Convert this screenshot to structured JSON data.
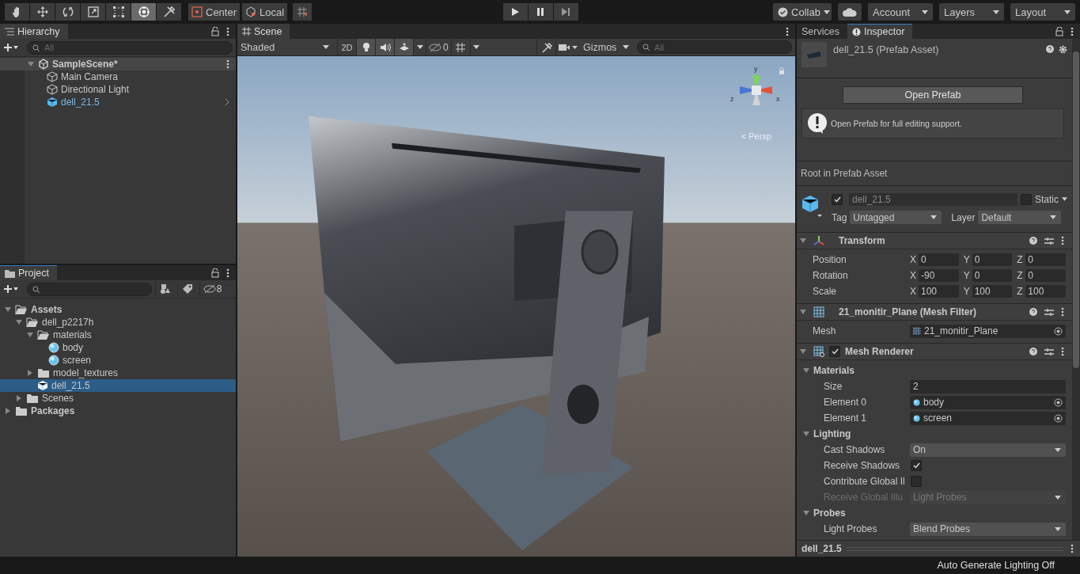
{
  "toolbar": {
    "tools": [
      {
        "kind": "hand",
        "selected": false
      },
      {
        "kind": "move",
        "selected": false
      },
      {
        "kind": "rotate",
        "selected": false
      },
      {
        "kind": "scale",
        "selected": false
      },
      {
        "kind": "rect",
        "selected": false
      },
      {
        "kind": "transform",
        "selected": true
      },
      {
        "kind": "custom",
        "selected": false
      }
    ],
    "pivot": "Center",
    "space": "Local",
    "play_controls": [
      {
        "kind": "play"
      },
      {
        "kind": "pause"
      },
      {
        "kind": "step"
      }
    ],
    "collab": "Collab",
    "account": "Account",
    "layers": "Layers",
    "layout": "Layout"
  },
  "hierarchy": {
    "title": "Hierarchy",
    "search_placeholder": "All",
    "scene": "SampleScene*",
    "expanded": true,
    "items": [
      {
        "name": "Main Camera",
        "kind": "object",
        "selected": false
      },
      {
        "name": "Directional Light",
        "kind": "object",
        "selected": false
      },
      {
        "name": "dell_21.5",
        "kind": "prefab",
        "selected": false
      }
    ]
  },
  "project": {
    "title": "Project",
    "hidden_count": "8",
    "tree": [
      {
        "name": "Assets",
        "kind": "folder",
        "expanded": true,
        "selected": false,
        "children": [
          {
            "name": "dell_p2217h",
            "kind": "folder",
            "expanded": true,
            "selected": false,
            "children": [
              {
                "name": "materials",
                "kind": "folder",
                "expanded": true,
                "selected": false,
                "children": [
                  {
                    "name": "body",
                    "kind": "material",
                    "selected": false
                  },
                  {
                    "name": "screen",
                    "kind": "material",
                    "selected": false
                  }
                ]
              },
              {
                "name": "model_textures",
                "kind": "folder",
                "expanded": false,
                "selected": false
              },
              {
                "name": "dell_21.5",
                "kind": "prefab",
                "selected": true
              }
            ]
          },
          {
            "name": "Scenes",
            "kind": "folder",
            "expanded": false,
            "selected": false
          }
        ]
      },
      {
        "name": "Packages",
        "kind": "folder",
        "expanded": false,
        "selected": false
      }
    ]
  },
  "scene": {
    "tab": "Scene",
    "shading": "Shaded",
    "mode_2d": "2D",
    "hidden_count": "0",
    "gizmos": "Gizmos",
    "search_placeholder": "All",
    "axes": [
      "y",
      "x",
      "z"
    ],
    "projection": "< Persp"
  },
  "inspector": {
    "tabs": [
      {
        "label": "Services",
        "selected": false
      },
      {
        "label": "Inspector",
        "selected": true
      }
    ],
    "asset_title": "dell_21.5 (Prefab Asset)",
    "open_button": "Open Prefab",
    "help_message": "Open Prefab for full editing support.",
    "root_label": "Root in Prefab Asset",
    "object": {
      "active": true,
      "name": "dell_21.5",
      "static": false,
      "static_label": "Static",
      "tag_label": "Tag",
      "tag": "Untagged",
      "layer_label": "Layer",
      "layer": "Default"
    },
    "components": [
      {
        "kind": "transform",
        "title": "Transform",
        "expanded": true,
        "rows": [
          {
            "kind": "vector",
            "label": "Position",
            "axes": [
              {
                "axis": "X",
                "value": "0"
              },
              {
                "axis": "Y",
                "value": "0"
              },
              {
                "axis": "Z",
                "value": "0"
              }
            ]
          },
          {
            "kind": "vector",
            "label": "Rotation",
            "axes": [
              {
                "axis": "X",
                "value": "-90"
              },
              {
                "axis": "Y",
                "value": "0"
              },
              {
                "axis": "Z",
                "value": "0"
              }
            ]
          },
          {
            "kind": "vector",
            "label": "Scale",
            "axes": [
              {
                "axis": "X",
                "value": "100"
              },
              {
                "axis": "Y",
                "value": "100"
              },
              {
                "axis": "Z",
                "value": "100"
              }
            ]
          }
        ]
      },
      {
        "kind": "mesh_filter",
        "title": "21_monitir_Plane (Mesh Filter)",
        "expanded": true,
        "rows": [
          {
            "kind": "object",
            "label": "Mesh",
            "value": "21_monitir_Plane"
          }
        ]
      },
      {
        "kind": "mesh_renderer",
        "title": "Mesh Renderer",
        "expanded": true,
        "enabled": true,
        "rows": [
          {
            "kind": "group",
            "label": "Materials",
            "expanded": true,
            "children": [
              {
                "kind": "text",
                "label": "Size",
                "value": "2"
              },
              {
                "kind": "object",
                "label": "Element 0",
                "value": "body"
              },
              {
                "kind": "object",
                "label": "Element 1",
                "value": "screen"
              }
            ]
          },
          {
            "kind": "group",
            "label": "Lighting",
            "expanded": true,
            "children": [
              {
                "kind": "dropdown",
                "label": "Cast Shadows",
                "value": "On",
                "disabled": false
              },
              {
                "kind": "checkbox",
                "label": "Receive Shadows",
                "checked": true
              },
              {
                "kind": "checkbox",
                "label": "Contribute Global Il",
                "checked": false
              },
              {
                "kind": "dropdown",
                "label": "Receive Global Illu",
                "value": "Light Probes",
                "disabled": true
              }
            ]
          },
          {
            "kind": "group",
            "label": "Probes",
            "expanded": true,
            "children": [
              {
                "kind": "dropdown",
                "label": "Light Probes",
                "value": "Blend Probes",
                "disabled": false
              }
            ]
          }
        ]
      }
    ],
    "footer": "dell_21.5"
  },
  "status_bar": {
    "message": "Auto Generate Lighting Off"
  }
}
